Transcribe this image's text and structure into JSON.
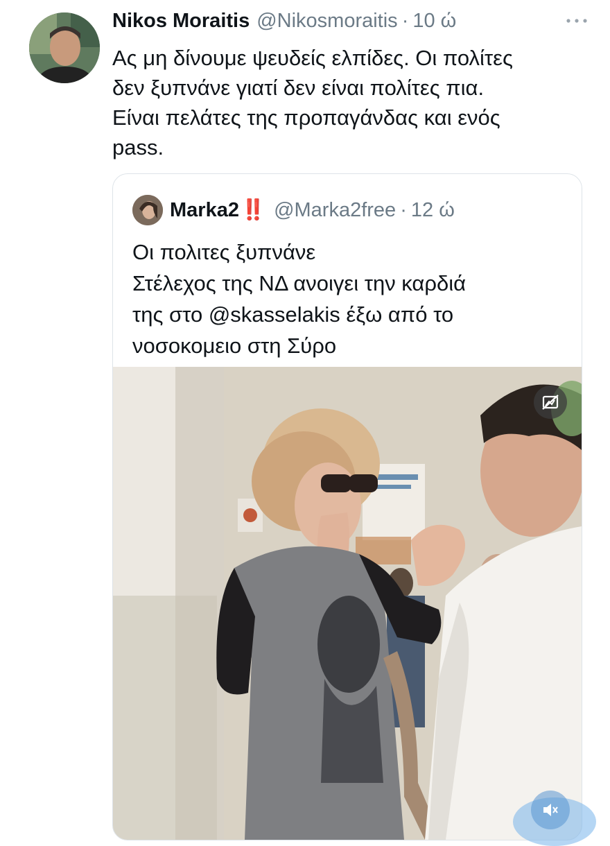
{
  "tweet": {
    "author": {
      "name": "Nikos Moraitis",
      "handle": "@Nikosmoraitis",
      "separator": "·",
      "time": "10 ώ"
    },
    "text_lines": [
      "Ας μη δίνουμε ψευδείς ελπίδες. Οι πολίτες",
      "δεν ξυπνάνε γιατί δεν είναι πολίτες πια.",
      "Είναι πελάτες της προπαγάνδας και ενός",
      "pass."
    ],
    "more_icon": "more-horizontal-icon"
  },
  "quote": {
    "author": {
      "name": "Marka2",
      "emoji": "‼️",
      "handle": "@Marka2free",
      "separator": "·",
      "time": "12 ώ"
    },
    "text_lines": [
      "Οι πολιτες ξυπνάνε",
      "Στέλεχος της ΝΔ ανοιγει την καρδιά",
      "της στο @skasselakis έξω από το",
      "νοσοκομειο στη Σύρο"
    ],
    "media": {
      "type": "video",
      "hide_icon": "hide-media-icon",
      "volume_icon": "muted-volume-icon"
    }
  },
  "colors": {
    "text": "#0f1419",
    "secondary": "#6b7a86",
    "border": "#dde3e8",
    "emoji_red": "#e0202a"
  }
}
